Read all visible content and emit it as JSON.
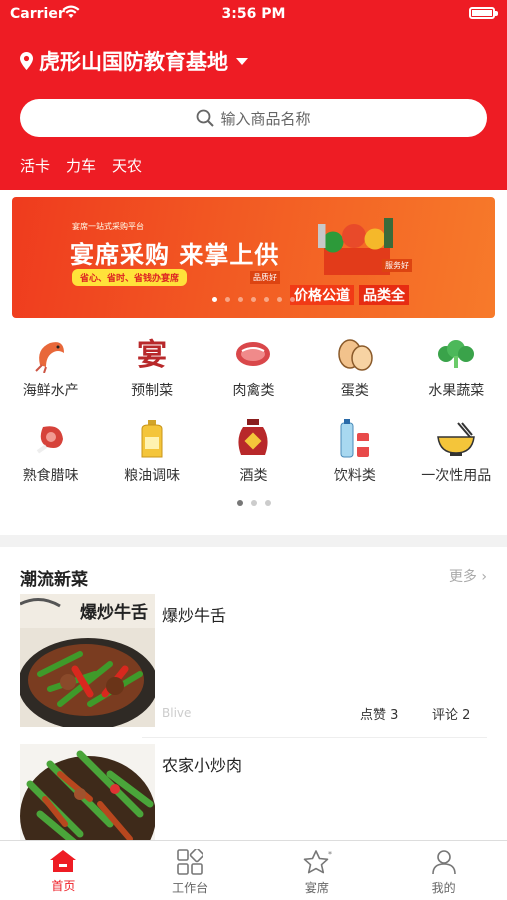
{
  "status_bar": {
    "carrier": "Carrier",
    "time": "3:56 PM"
  },
  "location": {
    "name": "虎形山国防教育基地"
  },
  "search": {
    "placeholder": "输入商品名称"
  },
  "hot_tags": [
    "活卡",
    "力车",
    "天农"
  ],
  "banner": {
    "subtitle": "宴席一站式采购平台",
    "title": "宴席采购 来掌上供",
    "slogan": "省心、省时、省钱办宴席",
    "badge_left": "品质好",
    "badge_right": "服务好",
    "price_text": "价格公道",
    "full_text": "品类全",
    "slide_count": 7,
    "active_slide": 0
  },
  "categories": [
    {
      "label": "海鲜水产",
      "icon": "shrimp-icon"
    },
    {
      "label": "预制菜",
      "icon": "banquet-icon"
    },
    {
      "label": "肉禽类",
      "icon": "meat-icon"
    },
    {
      "label": "蛋类",
      "icon": "egg-icon"
    },
    {
      "label": "水果蔬菜",
      "icon": "vegetable-icon"
    },
    {
      "label": "熟食腊味",
      "icon": "ham-icon"
    },
    {
      "label": "粮油调味",
      "icon": "oil-icon"
    },
    {
      "label": "酒类",
      "icon": "wine-jar-icon"
    },
    {
      "label": "饮料类",
      "icon": "drinks-icon"
    },
    {
      "label": "一次性用品",
      "icon": "bowl-icon"
    }
  ],
  "category_pages": {
    "count": 3,
    "active": 0
  },
  "section": {
    "title": "潮流新菜",
    "more": "更多"
  },
  "posts": [
    {
      "title": "爆炒牛舌",
      "thumb_text": "爆炒牛舌",
      "author": "Blive",
      "likes": "点赞 3",
      "comments": "评论 2"
    },
    {
      "title": "农家小炒肉"
    }
  ],
  "tabbar": [
    {
      "label": "首页",
      "icon": "home-icon",
      "active": true
    },
    {
      "label": "工作台",
      "icon": "grid-icon",
      "active": false
    },
    {
      "label": "宴席",
      "icon": "star-icon",
      "active": false
    },
    {
      "label": "我的",
      "icon": "user-icon",
      "active": false
    }
  ],
  "colors": {
    "brand_red": "#ee1c24",
    "tab_active": "#ee1c24"
  }
}
